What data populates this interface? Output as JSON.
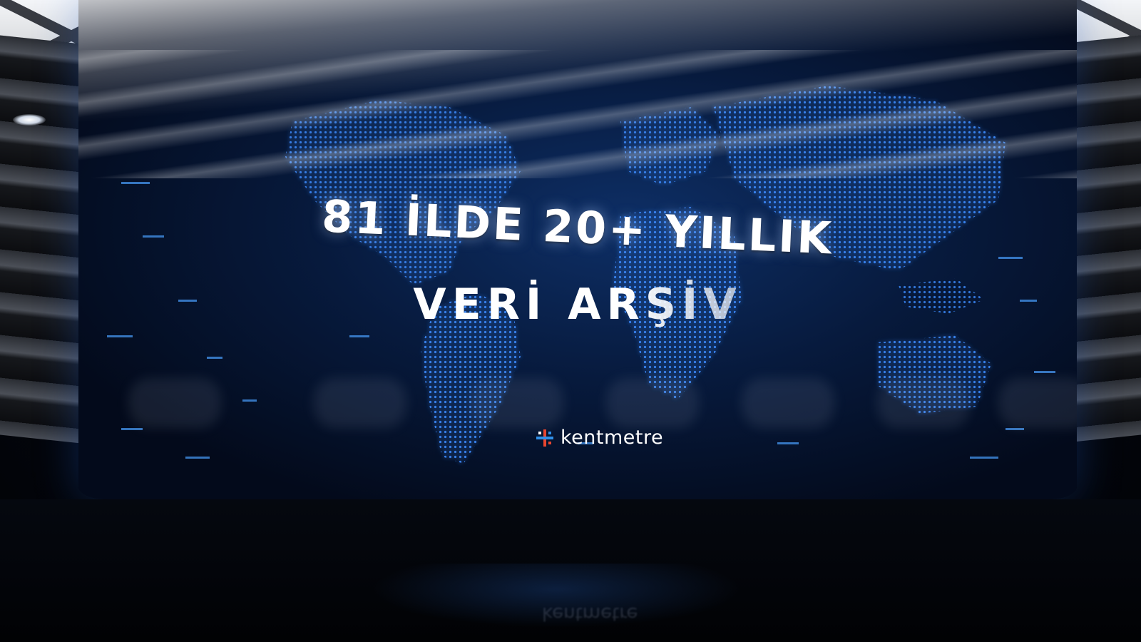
{
  "headline": {
    "line1": "81 İLDE 20+ YILLIK",
    "line2": "VERİ ARŞİV"
  },
  "brand": {
    "name": "kentmetre",
    "logo_icon": "kentmetre-logo-icon",
    "logo_colors": [
      "#e8452f",
      "#2f8fe8",
      "#ffffff"
    ]
  },
  "colors": {
    "screen_glow": "#1e5ac8",
    "map_dots": "#3d8cff",
    "background": "#020409"
  }
}
